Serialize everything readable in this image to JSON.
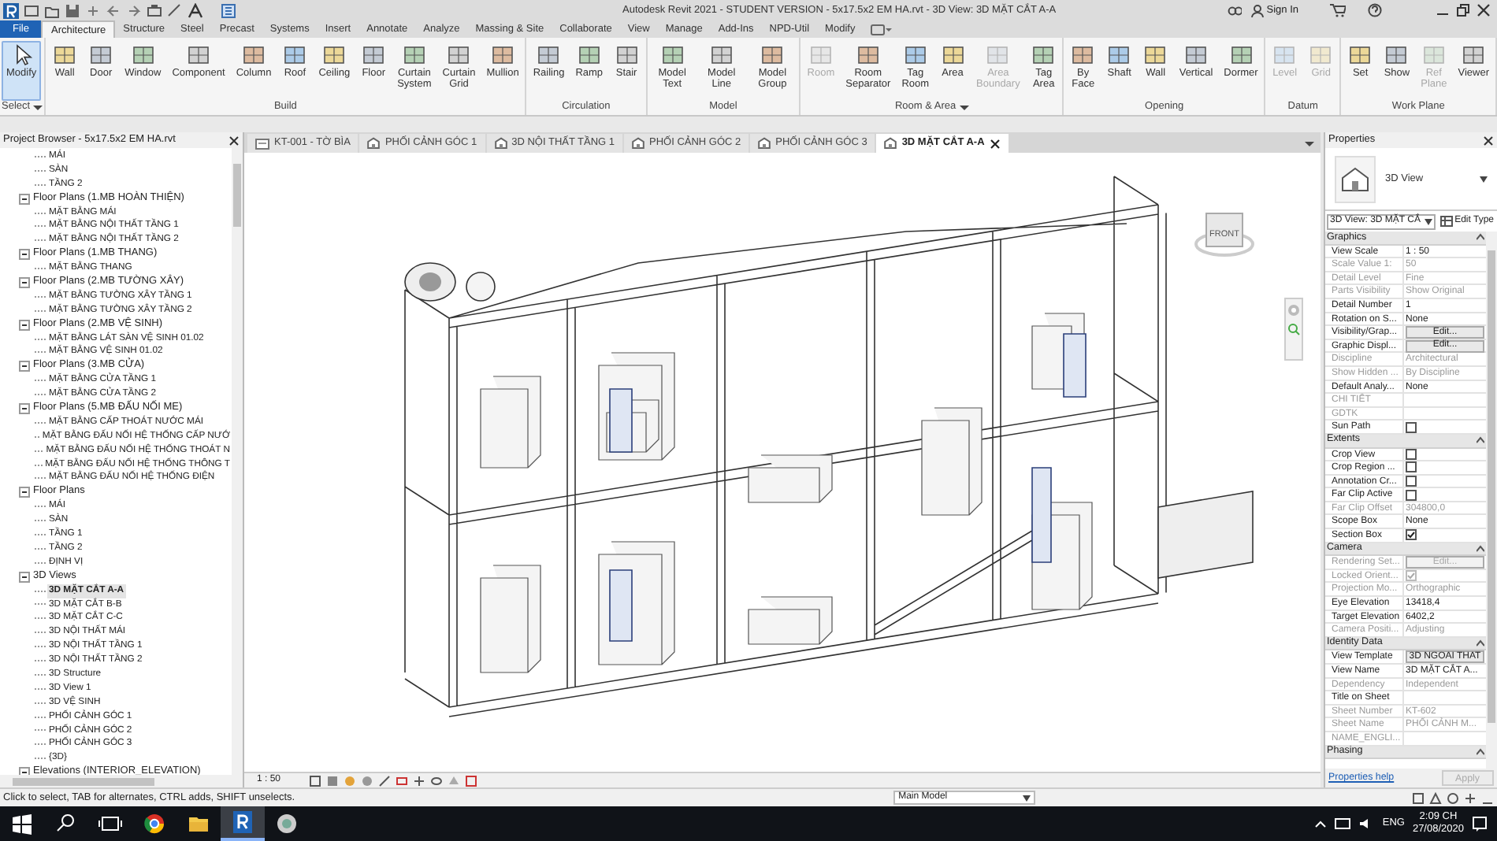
{
  "title_bar": {
    "title": "Autodesk Revit 2021 - STUDENT VERSION - 5x17.5x2 EM HA.rvt - 3D View: 3D MẶT CẮT A-A",
    "sign_in": "Sign In"
  },
  "ribbon_tabs": [
    {
      "label": "File",
      "kind": "file",
      "selected": false
    },
    {
      "label": "Architecture",
      "kind": "tab",
      "selected": true
    },
    {
      "label": "Structure",
      "kind": "tab",
      "selected": false
    },
    {
      "label": "Steel",
      "kind": "tab",
      "selected": false
    },
    {
      "label": "Precast",
      "kind": "tab",
      "selected": false
    },
    {
      "label": "Systems",
      "kind": "tab",
      "selected": false
    },
    {
      "label": "Insert",
      "kind": "tab",
      "selected": false
    },
    {
      "label": "Annotate",
      "kind": "tab",
      "selected": false
    },
    {
      "label": "Analyze",
      "kind": "tab",
      "selected": false
    },
    {
      "label": "Massing & Site",
      "kind": "tab",
      "selected": false
    },
    {
      "label": "Collaborate",
      "kind": "tab",
      "selected": false
    },
    {
      "label": "View",
      "kind": "tab",
      "selected": false
    },
    {
      "label": "Manage",
      "kind": "tab",
      "selected": false
    },
    {
      "label": "Add-Ins",
      "kind": "tab",
      "selected": false
    },
    {
      "label": "NPD-Util",
      "kind": "tab",
      "selected": false
    },
    {
      "label": "Modify",
      "kind": "tab",
      "selected": false
    }
  ],
  "ribbon_groups": [
    {
      "label": "Select",
      "dropdown": true,
      "tools": [
        {
          "label": "Modify",
          "selected": true,
          "disabled": false
        }
      ]
    },
    {
      "label": "Build",
      "dropdown": false,
      "tools": [
        {
          "label": "Wall",
          "selected": false,
          "disabled": false
        },
        {
          "label": "Door",
          "selected": false,
          "disabled": false
        },
        {
          "label": "Window",
          "selected": false,
          "disabled": false
        },
        {
          "label": "Component",
          "selected": false,
          "disabled": false
        },
        {
          "label": "Column",
          "selected": false,
          "disabled": false
        },
        {
          "label": "Roof",
          "selected": false,
          "disabled": false
        },
        {
          "label": "Ceiling",
          "selected": false,
          "disabled": false
        },
        {
          "label": "Floor",
          "selected": false,
          "disabled": false
        },
        {
          "label": "Curtain System",
          "selected": false,
          "disabled": false
        },
        {
          "label": "Curtain Grid",
          "selected": false,
          "disabled": false
        },
        {
          "label": "Mullion",
          "selected": false,
          "disabled": false
        }
      ]
    },
    {
      "label": "Circulation",
      "dropdown": false,
      "tools": [
        {
          "label": "Railing",
          "selected": false,
          "disabled": false
        },
        {
          "label": "Ramp",
          "selected": false,
          "disabled": false
        },
        {
          "label": "Stair",
          "selected": false,
          "disabled": false
        }
      ]
    },
    {
      "label": "Model",
      "dropdown": false,
      "tools": [
        {
          "label": "Model Text",
          "selected": false,
          "disabled": false
        },
        {
          "label": "Model Line",
          "selected": false,
          "disabled": false
        },
        {
          "label": "Model Group",
          "selected": false,
          "disabled": false
        }
      ]
    },
    {
      "label": "Room & Area",
      "dropdown": true,
      "tools": [
        {
          "label": "Room",
          "selected": false,
          "disabled": true
        },
        {
          "label": "Room Separator",
          "selected": false,
          "disabled": false
        },
        {
          "label": "Tag Room",
          "selected": false,
          "disabled": false
        },
        {
          "label": "Area",
          "selected": false,
          "disabled": false
        },
        {
          "label": "Area Boundary",
          "selected": false,
          "disabled": true
        },
        {
          "label": "Tag Area",
          "selected": false,
          "disabled": false
        }
      ]
    },
    {
      "label": "Opening",
      "dropdown": false,
      "tools": [
        {
          "label": "By Face",
          "selected": false,
          "disabled": false
        },
        {
          "label": "Shaft",
          "selected": false,
          "disabled": false
        },
        {
          "label": "Wall",
          "selected": false,
          "disabled": false
        },
        {
          "label": "Vertical",
          "selected": false,
          "disabled": false
        },
        {
          "label": "Dormer",
          "selected": false,
          "disabled": false
        }
      ]
    },
    {
      "label": "Datum",
      "dropdown": false,
      "tools": [
        {
          "label": "Level",
          "selected": false,
          "disabled": true
        },
        {
          "label": "Grid",
          "selected": false,
          "disabled": true
        }
      ]
    },
    {
      "label": "Work Plane",
      "dropdown": false,
      "tools": [
        {
          "label": "Set",
          "selected": false,
          "disabled": false
        },
        {
          "label": "Show",
          "selected": false,
          "disabled": false
        },
        {
          "label": "Ref Plane",
          "selected": false,
          "disabled": true
        },
        {
          "label": "Viewer",
          "selected": false,
          "disabled": false
        }
      ]
    }
  ],
  "project_browser": {
    "title": "Project Browser - 5x17.5x2 EM HA.rvt",
    "continued_items": [
      {
        "label": "MÁI"
      },
      {
        "label": "SÀN"
      },
      {
        "label": "TẦNG 2"
      }
    ],
    "tree": [
      {
        "label": "Floor Plans (1.MB HOÀN THIỆN)",
        "expanded": true,
        "children": [
          {
            "label": "MẶT BẰNG MÁI"
          },
          {
            "label": "MẶT BẰNG NỘI THẤT TẦNG 1"
          },
          {
            "label": "MẶT BẰNG NỘI THẤT TẦNG 2"
          }
        ]
      },
      {
        "label": "Floor Plans (1.MB THANG)",
        "expanded": true,
        "children": [
          {
            "label": "MẶT BẰNG THANG"
          }
        ]
      },
      {
        "label": "Floor Plans (2.MB TƯỜNG XÂY)",
        "expanded": true,
        "children": [
          {
            "label": "MẶT BẰNG TƯỜNG XÂY TẦNG 1"
          },
          {
            "label": "MẶT BẰNG TƯỜNG XÂY TẦNG 2"
          }
        ]
      },
      {
        "label": "Floor Plans (2.MB VỆ SINH)",
        "expanded": true,
        "children": [
          {
            "label": "MẶT BẰNG LÁT SÀN VỆ SINH 01.02"
          },
          {
            "label": "MẶT BẰNG VỆ SINH 01.02"
          }
        ]
      },
      {
        "label": "Floor Plans (3.MB CỬA)",
        "expanded": true,
        "children": [
          {
            "label": "MẶT BẰNG CỬA TẦNG 1"
          },
          {
            "label": "MẶT BẰNG CỬA TẦNG 2"
          }
        ]
      },
      {
        "label": "Floor Plans (5.MB ĐẤU NỐI ME)",
        "expanded": true,
        "children": [
          {
            "label": "MẶT BẰNG CẤP THOÁT NƯỚC MÁI"
          },
          {
            "label": "MẶT BẰNG ĐẤU NỐI HỆ THỐNG CẤP NƯỚ"
          },
          {
            "label": "MẶT BẰNG ĐẤU NỐI HỆ THỐNG THOÁT N"
          },
          {
            "label": "MẶT BẰNG ĐẤU NỐI HỆ THỐNG THÔNG T"
          },
          {
            "label": "MẶT BẰNG ĐẤU NỐI HỆ THỐNG ĐIỆN"
          }
        ]
      },
      {
        "label": "Floor Plans",
        "expanded": true,
        "children": [
          {
            "label": "MÁI"
          },
          {
            "label": "SÀN"
          },
          {
            "label": "TẦNG 1"
          },
          {
            "label": "TẦNG 2"
          },
          {
            "label": "ĐỊNH VỊ"
          }
        ]
      },
      {
        "label": "3D Views",
        "expanded": true,
        "children": [
          {
            "label": "3D MẶT CẮT A-A",
            "selected": true
          },
          {
            "label": "3D MẶT CẮT B-B",
            "selected": false
          },
          {
            "label": "3D MẶT CẮT C-C",
            "selected": false
          },
          {
            "label": "3D NỘI THẤT MÁI",
            "selected": false
          },
          {
            "label": "3D NỘI THẤT TẦNG 1",
            "selected": false
          },
          {
            "label": "3D NỘI THẤT TẦNG 2",
            "selected": false
          },
          {
            "label": "3D Structure",
            "selected": false
          },
          {
            "label": "3D View 1",
            "selected": false
          },
          {
            "label": "3D VỆ SINH",
            "selected": false
          },
          {
            "label": "PHỐI CẢNH GÓC 1",
            "selected": false
          },
          {
            "label": "PHỐI CẢNH GÓC 2",
            "selected": false
          },
          {
            "label": "PHỐI CẢNH GÓC 3",
            "selected": false
          },
          {
            "label": "{3D}",
            "selected": false
          }
        ]
      },
      {
        "label": "Elevations (INTERIOR_ELEVATION)",
        "expanded": true
      }
    ]
  },
  "view_tabs": [
    {
      "label": "KT-001 - TỜ BÌA",
      "kind": "sheet",
      "selected": false
    },
    {
      "label": "PHỐI CẢNH GÓC 1",
      "kind": "view",
      "selected": false
    },
    {
      "label": "3D NỘI THẤT TẦNG 1",
      "kind": "view",
      "selected": false
    },
    {
      "label": "PHỐI CẢNH GÓC 2",
      "kind": "view",
      "selected": false
    },
    {
      "label": "PHỐI CẢNH GÓC 3",
      "kind": "view",
      "selected": false
    },
    {
      "label": "3D MẶT CẮT A-A",
      "kind": "view",
      "selected": true
    }
  ],
  "view_cube": {
    "face": "FRONT"
  },
  "view_control_bar": {
    "scale": "1 : 50"
  },
  "properties": {
    "title": "Properties",
    "type_name": "3D View",
    "type_selector": "3D View: 3D MẶT CẮ",
    "edit_type": "Edit Type",
    "sections": [
      {
        "title": "Graphics",
        "rows": [
          {
            "name": "View Scale",
            "kind": "text",
            "value": "1 : 50",
            "disabled": false
          },
          {
            "name": "Scale Value  1:",
            "kind": "text",
            "value": "50",
            "disabled": true
          },
          {
            "name": "Detail Level",
            "kind": "text",
            "value": "Fine",
            "disabled": true
          },
          {
            "name": "Parts Visibility",
            "kind": "text",
            "value": "Show Original",
            "disabled": true
          },
          {
            "name": "Detail Number",
            "kind": "text",
            "value": "1",
            "disabled": false
          },
          {
            "name": "Rotation on S...",
            "kind": "text",
            "value": "None",
            "disabled": false
          },
          {
            "name": "Visibility/Grap...",
            "kind": "button",
            "value": "Edit...",
            "disabled": false
          },
          {
            "name": "Graphic Displ...",
            "kind": "button",
            "value": "Edit...",
            "disabled": false
          },
          {
            "name": "Discipline",
            "kind": "text",
            "value": "Architectural",
            "disabled": true
          },
          {
            "name": "Show Hidden ...",
            "kind": "text",
            "value": "By Discipline",
            "disabled": true
          },
          {
            "name": "Default Analy...",
            "kind": "text",
            "value": "None",
            "disabled": false
          },
          {
            "name": "CHI TIẾT",
            "kind": "text",
            "disabled": true
          },
          {
            "name": "GDTK",
            "kind": "text",
            "disabled": true
          },
          {
            "name": "Sun Path",
            "kind": "checkbox",
            "checked": false,
            "disabled": false
          }
        ]
      },
      {
        "title": "Extents",
        "rows": [
          {
            "name": "Crop View",
            "kind": "checkbox",
            "checked": false,
            "disabled": false
          },
          {
            "name": "Crop Region ...",
            "kind": "checkbox",
            "checked": false,
            "disabled": false
          },
          {
            "name": "Annotation Cr...",
            "kind": "checkbox",
            "checked": false,
            "disabled": false
          },
          {
            "name": "Far Clip Active",
            "kind": "checkbox",
            "checked": false,
            "disabled": false
          },
          {
            "name": "Far Clip Offset",
            "kind": "text",
            "value": "304800,0",
            "disabled": true
          },
          {
            "name": "Scope Box",
            "kind": "text",
            "value": "None",
            "disabled": false
          },
          {
            "name": "Section Box",
            "kind": "checkbox",
            "checked": true,
            "disabled": false
          }
        ]
      },
      {
        "title": "Camera",
        "rows": [
          {
            "name": "Rendering Set...",
            "kind": "button",
            "value": "Edit...",
            "disabled": true
          },
          {
            "name": "Locked Orient...",
            "kind": "checkbox",
            "checked": true,
            "disabled": true
          },
          {
            "name": "Projection Mo...",
            "kind": "text",
            "value": "Orthographic",
            "disabled": true
          },
          {
            "name": "Eye Elevation",
            "kind": "text",
            "value": "13418,4",
            "disabled": false
          },
          {
            "name": "Target Elevation",
            "kind": "text",
            "value": "6402,2",
            "disabled": false
          },
          {
            "name": "Camera Positi...",
            "kind": "text",
            "value": "Adjusting",
            "disabled": true
          }
        ]
      },
      {
        "title": "Identity Data",
        "rows": [
          {
            "name": "View Template",
            "kind": "button",
            "value": "3D NGOAI THAT",
            "disabled": false
          },
          {
            "name": "View Name",
            "kind": "text",
            "value": "3D MẶT CẮT A...",
            "disabled": false
          },
          {
            "name": "Dependency",
            "kind": "text",
            "value": "Independent",
            "disabled": true
          },
          {
            "name": "Title on Sheet",
            "kind": "text",
            "disabled": false
          },
          {
            "name": "Sheet Number",
            "kind": "text",
            "value": "KT-602",
            "disabled": true
          },
          {
            "name": "Sheet Name",
            "kind": "text",
            "value": "PHỐI CẢNH M...",
            "disabled": true
          },
          {
            "name": "NAME_ENGLI...",
            "kind": "text",
            "disabled": true
          }
        ]
      },
      {
        "title": "Phasing"
      }
    ],
    "help_link": "Properties help",
    "apply_button": {
      "label": "Apply",
      "disabled": true
    }
  },
  "status_bar": {
    "message": "Click to select, TAB for alternates, CTRL adds, SHIFT unselects.",
    "model": "Main Model"
  },
  "taskbar": {
    "apps": [
      {
        "kind": "start",
        "active": false
      },
      {
        "kind": "search",
        "active": false
      },
      {
        "kind": "task-view",
        "active": false
      },
      {
        "kind": "browser",
        "active": false
      },
      {
        "kind": "folder",
        "active": false
      },
      {
        "kind": "revit",
        "active": true
      },
      {
        "kind": "app",
        "active": false
      }
    ],
    "language": "ENG",
    "time": "2:09 CH",
    "date": "27/08/2020"
  }
}
